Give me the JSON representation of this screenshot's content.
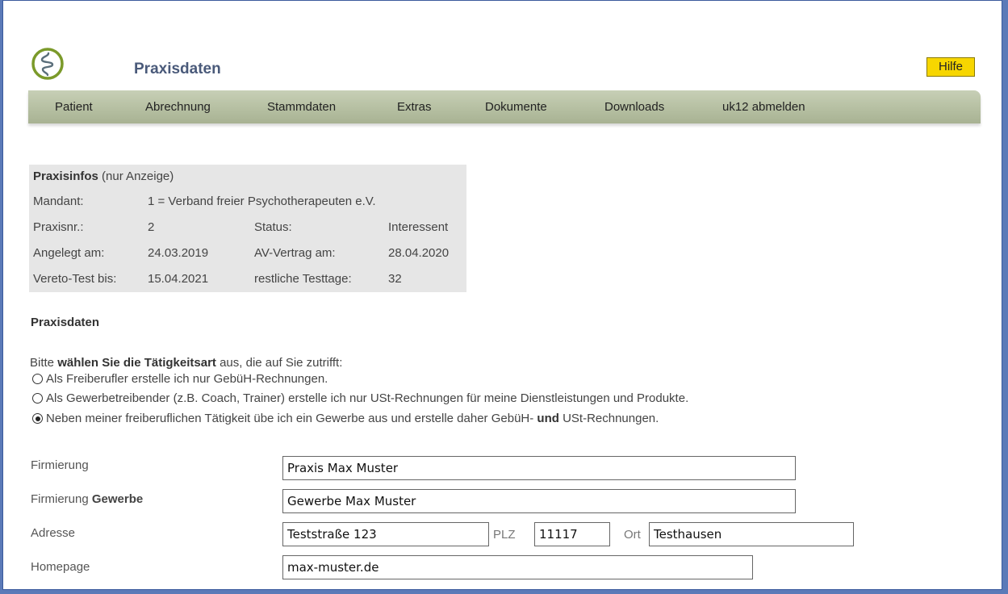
{
  "header": {
    "title": "Praxisdaten",
    "help_label": "Hilfe",
    "logo_icon": "praxis-logo-icon"
  },
  "nav": {
    "items": [
      {
        "label": "Patient"
      },
      {
        "label": "Abrechnung"
      },
      {
        "label": "Stammdaten"
      },
      {
        "label": "Extras"
      },
      {
        "label": "Dokumente"
      },
      {
        "label": "Downloads"
      },
      {
        "label": "uk12 abmelden"
      }
    ]
  },
  "info": {
    "title": "Praxisinfos",
    "subtitle": "(nur Anzeige)",
    "mandant_label": "Mandant:",
    "mandant_value": "1 = Verband freier Psychotherapeuten e.V.",
    "praxisnr_label": "Praxisnr.:",
    "praxisnr_value": "2",
    "status_label": "Status:",
    "status_value": "Interessent",
    "angelegt_label": "Angelegt am:",
    "angelegt_value": "24.03.2019",
    "av_label": "AV-Vertrag am:",
    "av_value": "28.04.2020",
    "test_label": "Vereto-Test bis:",
    "test_value": "15.04.2021",
    "testtage_label": "restliche Testtage:",
    "testtage_value": "32"
  },
  "section": {
    "title": "Praxisdaten",
    "instr_pre": "Bitte ",
    "instr_bold": "wählen Sie die Tätigkeitsart",
    "instr_post": " aus, die auf Sie zutrifft:",
    "options": [
      {
        "label": "Als Freiberufler erstelle ich nur GebüH-Rechnungen.",
        "checked": false
      },
      {
        "label": "Als Gewerbetreibender (z.B. Coach, Trainer) erstelle ich nur USt-Rechnungen für meine Dienstleistungen und Produkte.",
        "checked": false
      },
      {
        "label_pre": "Neben meiner freiberuflichen Tätigkeit übe ich ein Gewerbe aus und erstelle daher GebüH- ",
        "label_bold": "und",
        "label_post": " USt-Rechnungen.",
        "checked": true
      }
    ]
  },
  "form": {
    "firmierung_label": "Firmierung",
    "firmierung_value": "Praxis Max Muster",
    "gewerbe_label_pre": "Firmierung ",
    "gewerbe_label_bold": "Gewerbe",
    "gewerbe_value": "Gewerbe Max Muster",
    "adresse_label": "Adresse",
    "adresse_value": "Teststraße 123",
    "plz_label": "PLZ",
    "plz_value": "11117",
    "ort_label": "Ort",
    "ort_value": "Testhausen",
    "homepage_label": "Homepage",
    "homepage_value": "max-muster.de"
  }
}
